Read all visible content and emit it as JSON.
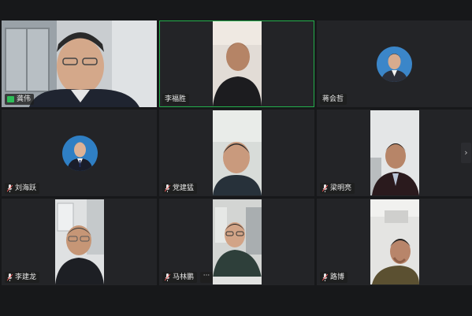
{
  "participants": [
    {
      "name": "龚伟",
      "indicator": "signal-icon"
    },
    {
      "name": "李福胜",
      "indicator": "none"
    },
    {
      "name": "蒋会哲",
      "indicator": "none"
    },
    {
      "name": "刘海跃",
      "indicator": "mic-muted-icon"
    },
    {
      "name": "党建猛",
      "indicator": "mic-muted-icon"
    },
    {
      "name": "梁明亮",
      "indicator": "mic-muted-icon"
    },
    {
      "name": "李建龙",
      "indicator": "mic-muted-icon"
    },
    {
      "name": "马林鹏",
      "indicator": "mic-muted-icon"
    },
    {
      "name": "路博",
      "indicator": "mic-muted-icon"
    }
  ],
  "active_speaker": "李福胜",
  "more_button_label": "···",
  "next_page_label": "›",
  "colors": {
    "background": "#17181a",
    "tile": "#232427",
    "active_border": "#23b04c",
    "name_tag": "#1e1e1e"
  }
}
